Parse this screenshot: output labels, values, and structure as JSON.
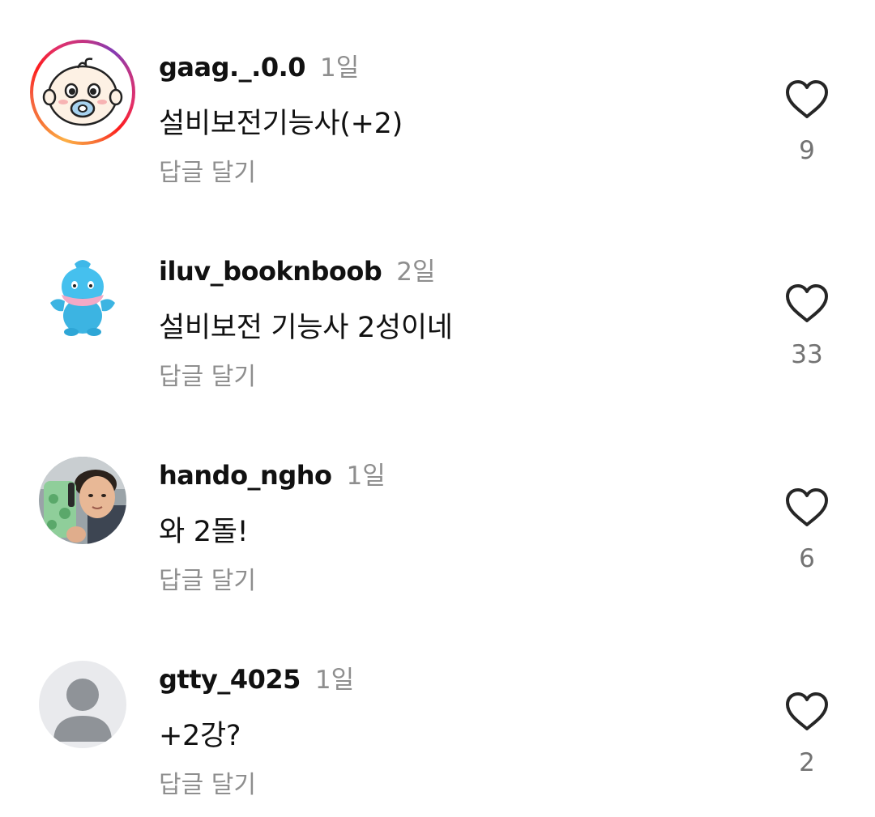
{
  "comments": [
    {
      "username": "gaag._.0.0",
      "time": "1일",
      "text": "설비보전기능사(+2)",
      "reply_label": "답글 달기",
      "likes": "9",
      "avatar": "baby-cartoon-avatar",
      "has_story_ring": true
    },
    {
      "username": "iluv_booknboob",
      "time": "2일",
      "text": "설비보전 기능사 2성이네",
      "reply_label": "답글 달기",
      "likes": "33",
      "avatar": "blue-plush-avatar",
      "has_story_ring": false
    },
    {
      "username": "hando_ngho",
      "time": "1일",
      "text": "와 2돌!",
      "reply_label": "답글 달기",
      "likes": "6",
      "avatar": "selfie-photo-avatar",
      "has_story_ring": false
    },
    {
      "username": "gtty_4025",
      "time": "1일",
      "text": "+2강?",
      "reply_label": "답글 달기",
      "likes": "2",
      "avatar": "default-user-avatar",
      "has_story_ring": false
    }
  ],
  "icons": {
    "like": "heart-outline-icon"
  },
  "colors": {
    "text_primary": "#111111",
    "text_secondary": "#8e8e8e",
    "like_count": "#737373",
    "heart_stroke": "#262626"
  }
}
